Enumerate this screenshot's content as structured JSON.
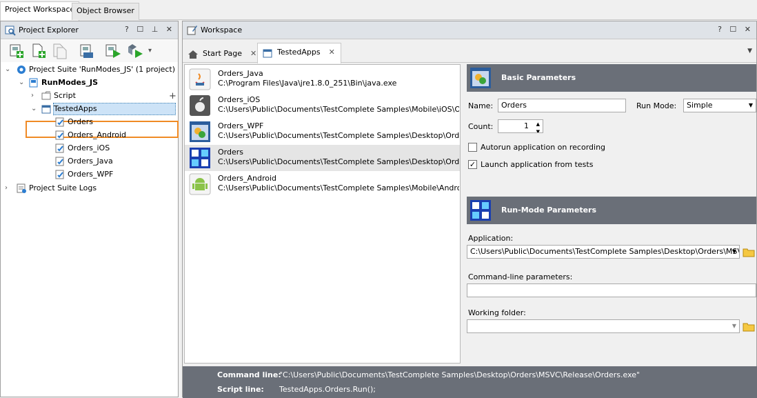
{
  "top_tabs": [
    {
      "label": "Project Workspace",
      "active": true
    },
    {
      "label": "Object Browser",
      "active": false
    }
  ],
  "explorer": {
    "title": "Project Explorer",
    "controls": "? ☐ ⊥ ✕",
    "tree": [
      {
        "label": "Project Suite 'RunModes_JS' (1 project)"
      },
      {
        "label": "RunModes_JS"
      },
      {
        "label": "Script"
      },
      {
        "label": "TestedApps"
      },
      {
        "label": "Orders"
      },
      {
        "label": "Orders_Android"
      },
      {
        "label": "Orders_iOS"
      },
      {
        "label": "Orders_Java"
      },
      {
        "label": "Orders_WPF"
      },
      {
        "label": "Project Suite Logs"
      }
    ],
    "add_glyph": "+"
  },
  "workspace": {
    "title": "Workspace",
    "controls": "? ☐ ✕",
    "tabs": [
      {
        "label": "Start Page"
      },
      {
        "label": "TestedApps"
      }
    ],
    "close_glyph": "✕",
    "menu_glyph": "▼"
  },
  "apps": [
    {
      "name": "Orders_Java",
      "path": "C:\\Program Files\\Java\\jre1.8.0_251\\Bin\\java.exe"
    },
    {
      "name": "Orders_iOS",
      "path": "C:\\Users\\Public\\Documents\\TestComplete Samples\\Mobile\\iOS\\Orders\\..."
    },
    {
      "name": "Orders_WPF",
      "path": "C:\\Users\\Public\\Documents\\TestComplete Samples\\Desktop\\Orders\\W..."
    },
    {
      "name": "Orders",
      "path": "C:\\Users\\Public\\Documents\\TestComplete Samples\\Desktop\\Orders\\M..."
    },
    {
      "name": "Orders_Android",
      "path": "C:\\Users\\Public\\Documents\\TestComplete Samples\\Mobile\\Android\\Or..."
    }
  ],
  "basic": {
    "title": "Basic Parameters",
    "name_label": "Name:",
    "name_value": "Orders",
    "run_mode_label": "Run Mode:",
    "run_mode_value": "Simple",
    "count_label": "Count:",
    "count_value": "1",
    "autorun_label": "Autorun application on recording",
    "autorun_checked": false,
    "launch_label": "Launch application from tests",
    "launch_checked": true,
    "check_glyph": "✓"
  },
  "runmode": {
    "title": "Run-Mode Parameters",
    "application_label": "Application:",
    "application_value": "C:\\Users\\Public\\Documents\\TestComplete Samples\\Desktop\\Orders\\MSVC\\Rele",
    "cmdline_label": "Command-line parameters:",
    "cmdline_value": "",
    "workdir_label": "Working folder:",
    "workdir_value": ""
  },
  "status": {
    "command_label": "Command line:",
    "command_value": "\"C:\\Users\\Public\\Documents\\TestComplete Samples\\Desktop\\Orders\\MSVC\\Release\\Orders.exe\"",
    "script_label": "Script line:",
    "script_value": "TestedApps.Orders.Run();"
  }
}
